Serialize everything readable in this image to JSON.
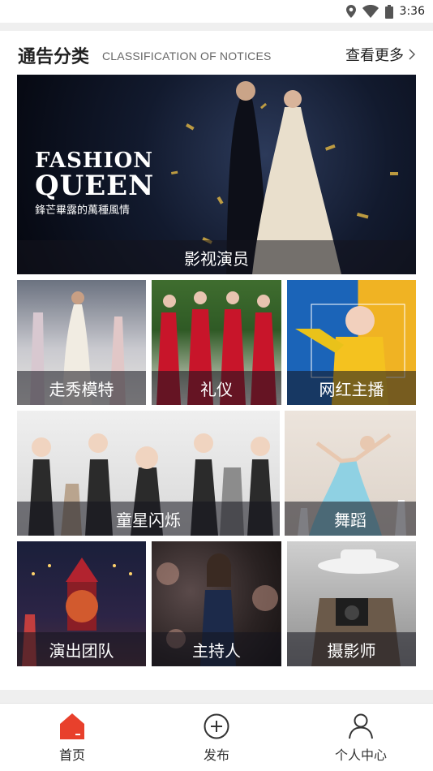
{
  "status": {
    "time": "3:36",
    "icons": [
      "location-icon",
      "wifi-icon",
      "battery-icon"
    ]
  },
  "section": {
    "title": "通告分类",
    "subtitle": "CLASSIFICATION OF NOTICES",
    "more_label": "查看更多"
  },
  "banner": {
    "label": "影视演员",
    "logo_line1": "FASHION",
    "logo_line2": "QUEEN",
    "logo_sub": "鋒芒畢露的萬種風情"
  },
  "categories": [
    {
      "label": "走秀模特"
    },
    {
      "label": "礼仪"
    },
    {
      "label": "网红主播"
    },
    {
      "label": "童星闪烁"
    },
    {
      "label": "舞蹈"
    },
    {
      "label": "演出团队"
    },
    {
      "label": "主持人"
    },
    {
      "label": "摄影师"
    }
  ],
  "nav": [
    {
      "label": "首页",
      "icon": "home-icon",
      "active": true
    },
    {
      "label": "发布",
      "icon": "plus-circle-icon"
    },
    {
      "label": "个人中心",
      "icon": "person-icon"
    }
  ],
  "colors": {
    "accent": "#e8402c",
    "label_overlay": "rgba(20,20,30,0.55)"
  }
}
